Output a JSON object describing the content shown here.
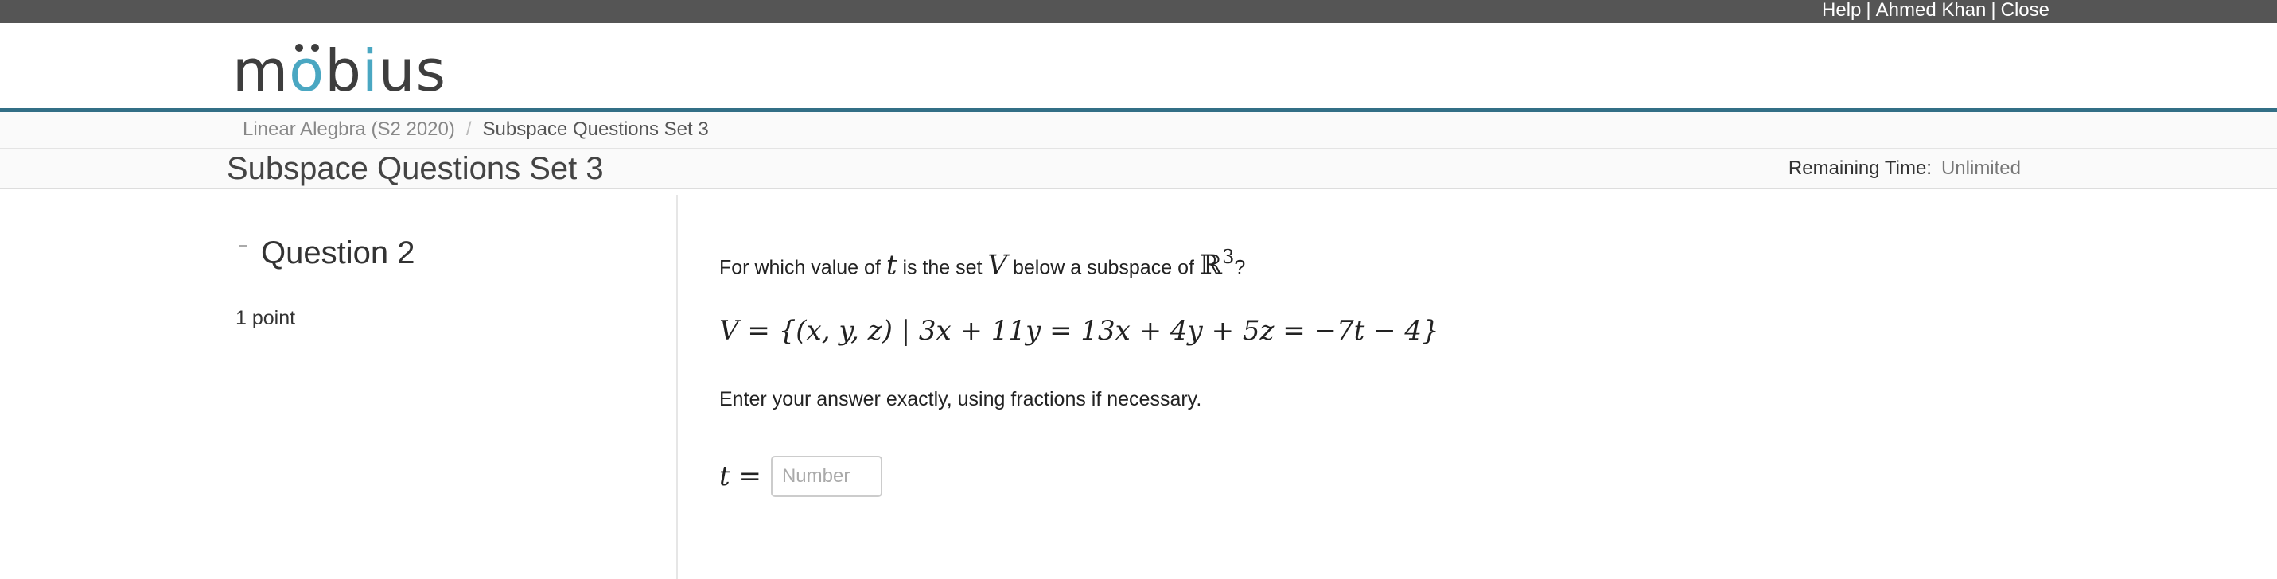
{
  "topbar": {
    "help": "Help",
    "user": "Ahmed Khan",
    "close": "Close",
    "separator": "|"
  },
  "logo": {
    "text_start": "m",
    "text_o": "o",
    "text_b": "b",
    "text_i": "i",
    "text_us": "us"
  },
  "breadcrumb": {
    "course": "Linear Alegbra (S2 2020)",
    "separator": "/",
    "current": "Subspace Questions Set 3"
  },
  "page": {
    "title": "Subspace Questions Set 3",
    "remaining_label": "Remaining Time:",
    "remaining_value": "Unlimited"
  },
  "question": {
    "title": "Question 2",
    "points": "1 point",
    "prompt_1": "For which value of",
    "prompt_var_t": "t",
    "prompt_2": "is the set",
    "prompt_var_V": "V",
    "prompt_3": "below a subspace of",
    "prompt_R": "ℝ",
    "prompt_exp": "3",
    "prompt_4": "?",
    "equation": "V = {(x, y, z) | 3x + 11y = 13x + 4y + 5z = −7t − 4}",
    "instruction": "Enter your answer exactly, using fractions if necessary.",
    "answer_label": "t =",
    "answer_placeholder": "Number",
    "answer_value": ""
  },
  "colors": {
    "topbar": "#555555",
    "accent_line": "#336f86",
    "logo_accent": "#4aa7c2"
  }
}
